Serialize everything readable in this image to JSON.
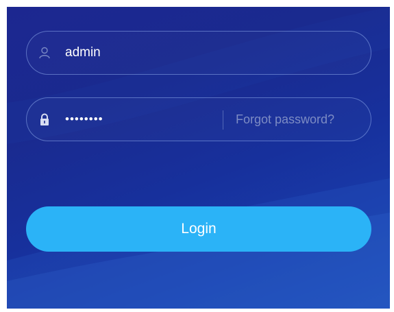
{
  "login_form": {
    "username": {
      "value": "admin",
      "icon": "user-icon"
    },
    "password": {
      "masked_value": "••••••••",
      "icon": "lock-icon",
      "forgot_label": "Forgot password?"
    },
    "login_label": "Login"
  },
  "colors": {
    "background_top": "#1c2790",
    "background_bottom": "#1c4ab6",
    "button": "#2bb3f7",
    "field_border": "#8caaeb",
    "forgot_text": "#7d8cc4"
  }
}
